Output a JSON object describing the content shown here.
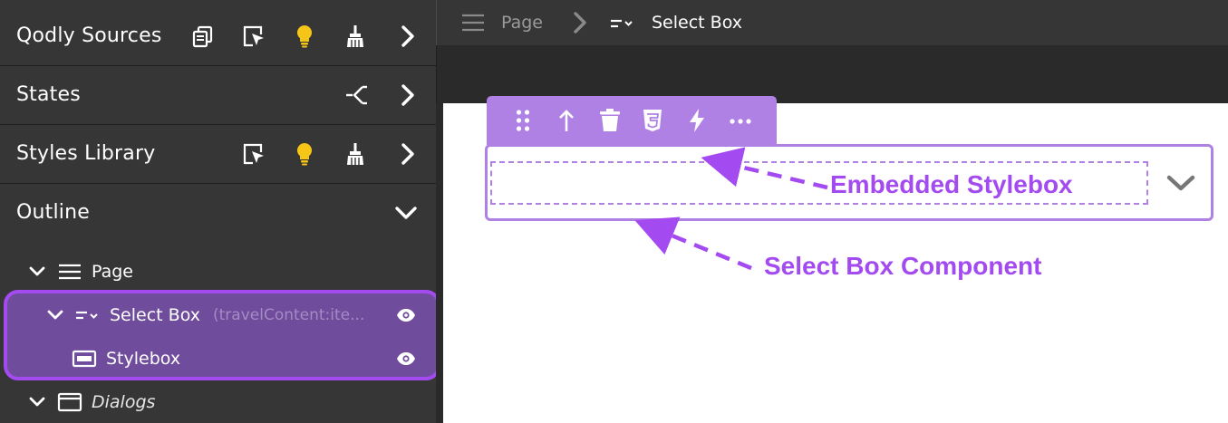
{
  "left_panel": {
    "sections": [
      {
        "title": "Qodly Sources",
        "icons": [
          "duplicate-icon",
          "select-element-icon",
          "lightbulb-icon",
          "broom-icon",
          "chevron-right-icon"
        ]
      },
      {
        "title": "States",
        "icons": [
          "states-branch-icon",
          "chevron-right-icon"
        ]
      },
      {
        "title": "Styles Library",
        "icons": [
          "select-element-icon",
          "lightbulb-icon",
          "broom-icon",
          "chevron-right-icon"
        ]
      },
      {
        "title": "Outline",
        "icons": [
          "chevron-down-icon"
        ]
      }
    ],
    "tree": [
      {
        "label": "Page",
        "icon": "page-lines-icon",
        "expanded": true
      },
      {
        "label": "Select Box",
        "sub": "(travelContent:ite...",
        "icon": "select-box-icon",
        "expanded": true,
        "selected": true,
        "visible_icon": "eye-icon"
      },
      {
        "label": "Stylebox",
        "icon": "stylebox-icon",
        "selected": true,
        "visible_icon": "eye-icon"
      },
      {
        "label": "Dialogs",
        "icon": "dialog-window-icon",
        "expanded": true,
        "italic": true
      }
    ]
  },
  "breadcrumb": {
    "items": [
      "Page",
      "Select Box"
    ],
    "separator_icon": "chevron-right-icon"
  },
  "component_toolbar": {
    "icons": [
      "drag-handle-icon",
      "select-parent-arrow-icon",
      "trash-icon",
      "css-icon",
      "events-lightning-icon",
      "more-options-icon"
    ]
  },
  "annotations": {
    "embedded": "Embedded Stylebox",
    "component": "Select Box Component"
  },
  "colors": {
    "accent_purple": "#a34bf0",
    "toolbar_purple": "#b081e4",
    "selection_fill": "#6f4c9c",
    "lightbulb_yellow": "#f5c518",
    "panel_bg": "#363636"
  }
}
